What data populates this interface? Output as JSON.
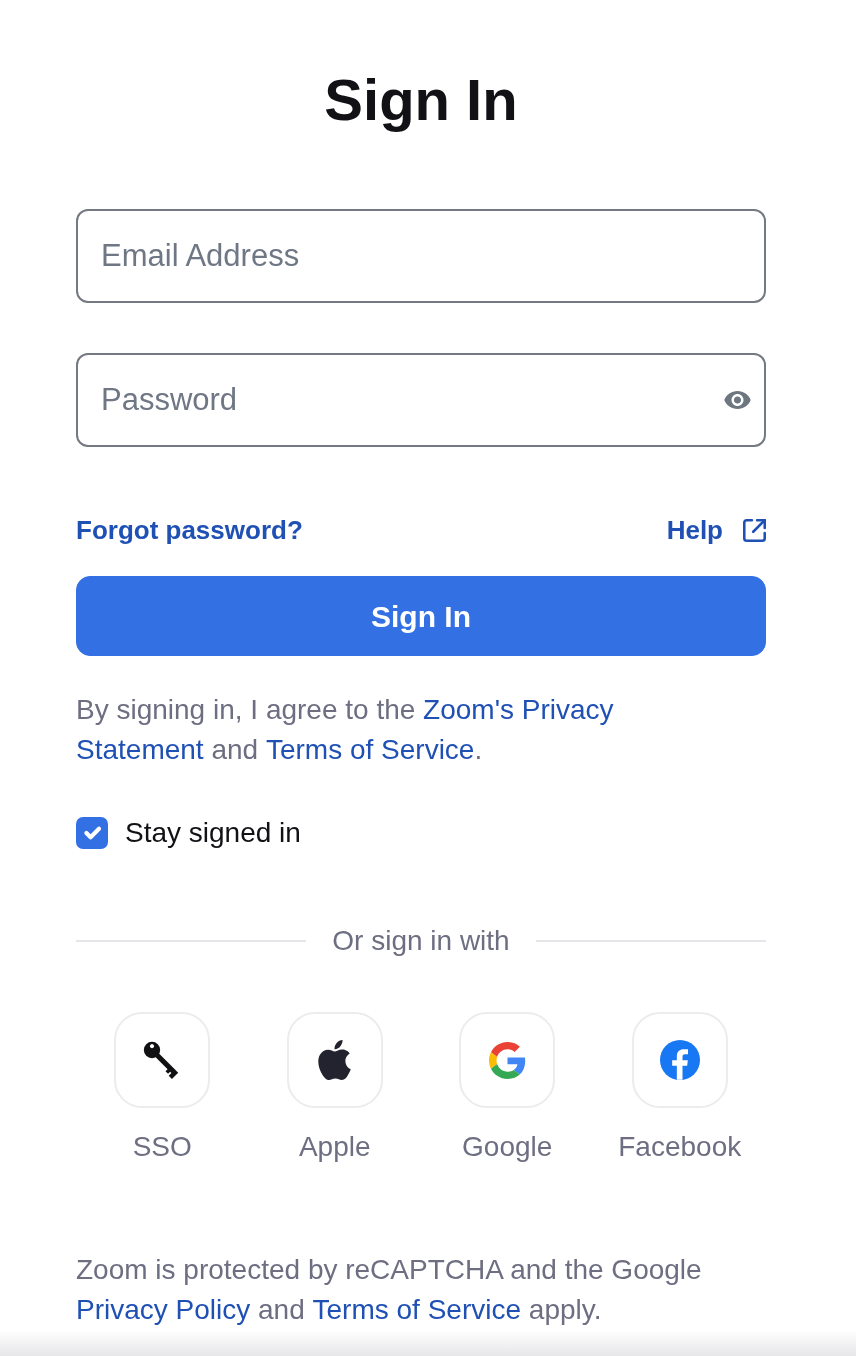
{
  "title": "Sign In",
  "fields": [
    {
      "kind": "email",
      "placeholder": "Email Address"
    },
    {
      "kind": "password",
      "placeholder": "Password"
    }
  ],
  "links": {
    "forgot_password": "Forgot password?",
    "help": "Help"
  },
  "sign_in_button": "Sign In",
  "agreement": [
    {
      "kind": "text",
      "text": "By signing in, I agree to the "
    },
    {
      "kind": "link",
      "text": "Zoom's Privacy"
    },
    {
      "kind": "link",
      "text": "Statement"
    },
    {
      "kind": "text",
      "text": " and "
    },
    {
      "kind": "link",
      "text": "Terms of Service"
    },
    {
      "kind": "text",
      "text": "."
    }
  ],
  "stay_signed_in": {
    "label": "Stay signed in",
    "checked": true
  },
  "social_sign_in": {
    "heading": "Or sign in with",
    "providers": [
      {
        "kind": "sso",
        "label": "SSO"
      },
      {
        "kind": "apple",
        "label": "Apple"
      },
      {
        "kind": "google",
        "label": "Google"
      },
      {
        "kind": "facebook",
        "label": "Facebook"
      }
    ]
  },
  "recaptcha_notice": [
    {
      "kind": "text",
      "text": "Zoom is protected by reCAPTCHA and the Google "
    },
    {
      "kind": "link",
      "text": "Privacy Policy"
    },
    {
      "kind": "text",
      "text": " and "
    },
    {
      "kind": "link",
      "text": "Terms of Service"
    },
    {
      "kind": "text",
      "text": " apply."
    }
  ]
}
